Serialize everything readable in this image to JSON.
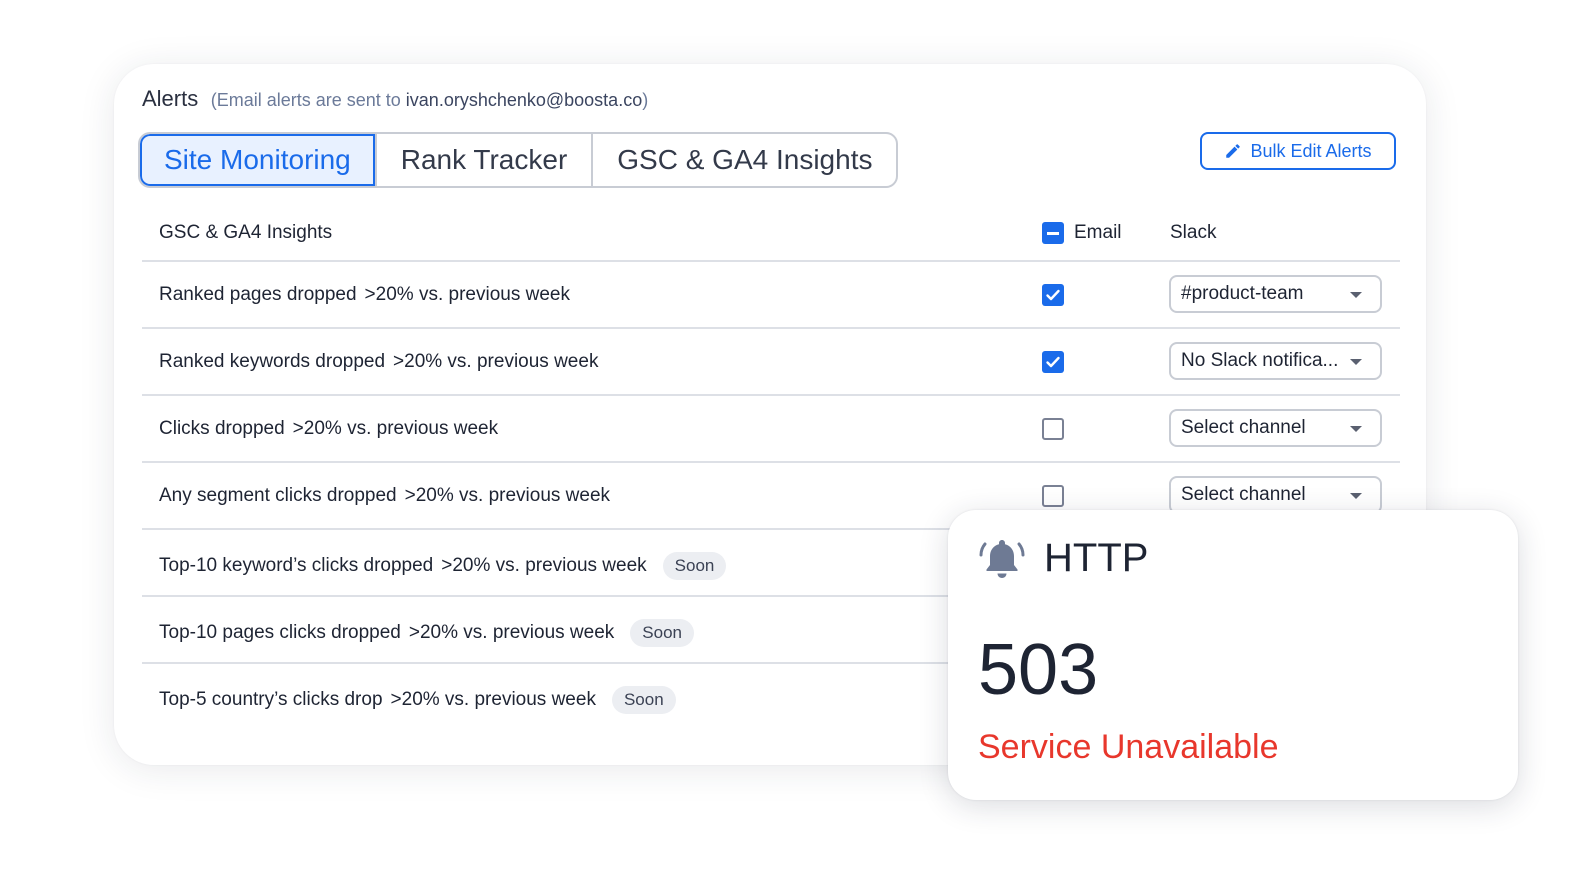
{
  "header": {
    "title": "Alerts",
    "note_prefix": "(Email alerts are sent to",
    "email": "ivan.oryshchenko@boosta.co",
    "note_suffix": ")"
  },
  "tabs": [
    {
      "label": "Site Monitoring",
      "active": true
    },
    {
      "label": "Rank Tracker",
      "active": false
    },
    {
      "label": "GSC & GA4 Insights",
      "active": false
    }
  ],
  "bulk_edit_label": "Bulk Edit Alerts",
  "table": {
    "section_title": "GSC & GA4 Insights",
    "email_header": "Email",
    "slack_header": "Slack",
    "rows": [
      {
        "name": "Ranked pages dropped",
        "threshold": ">20% vs. previous week",
        "email_checked": true,
        "slack": "#product-team",
        "badge": ""
      },
      {
        "name": "Ranked keywords dropped",
        "threshold": ">20% vs. previous week",
        "email_checked": true,
        "slack": "No Slack notifica...",
        "badge": ""
      },
      {
        "name": "Clicks dropped",
        "threshold": ">20% vs. previous week",
        "email_checked": false,
        "slack": "Select channel",
        "badge": ""
      },
      {
        "name": "Any segment clicks dropped",
        "threshold": ">20% vs. previous week",
        "email_checked": false,
        "slack": "Select channel",
        "badge": ""
      },
      {
        "name": "Top-10 keyword’s clicks dropped",
        "threshold": ">20% vs. previous week",
        "email_checked": null,
        "slack": "",
        "badge": "Soon"
      },
      {
        "name": "Top-10 pages clicks dropped",
        "threshold": ">20% vs. previous week",
        "email_checked": null,
        "slack": "",
        "badge": "Soon"
      },
      {
        "name": "Top-5 country’s clicks drop",
        "threshold": ">20% vs. previous week",
        "email_checked": null,
        "slack": "",
        "badge": "Soon"
      }
    ]
  },
  "popup": {
    "icon": "bell-icon",
    "protocol": "HTTP",
    "code": "503",
    "status": "Service Unavailable",
    "status_color": "#e8372c"
  },
  "colors": {
    "accent": "#1a6bea",
    "border": "#c8ccd4"
  }
}
